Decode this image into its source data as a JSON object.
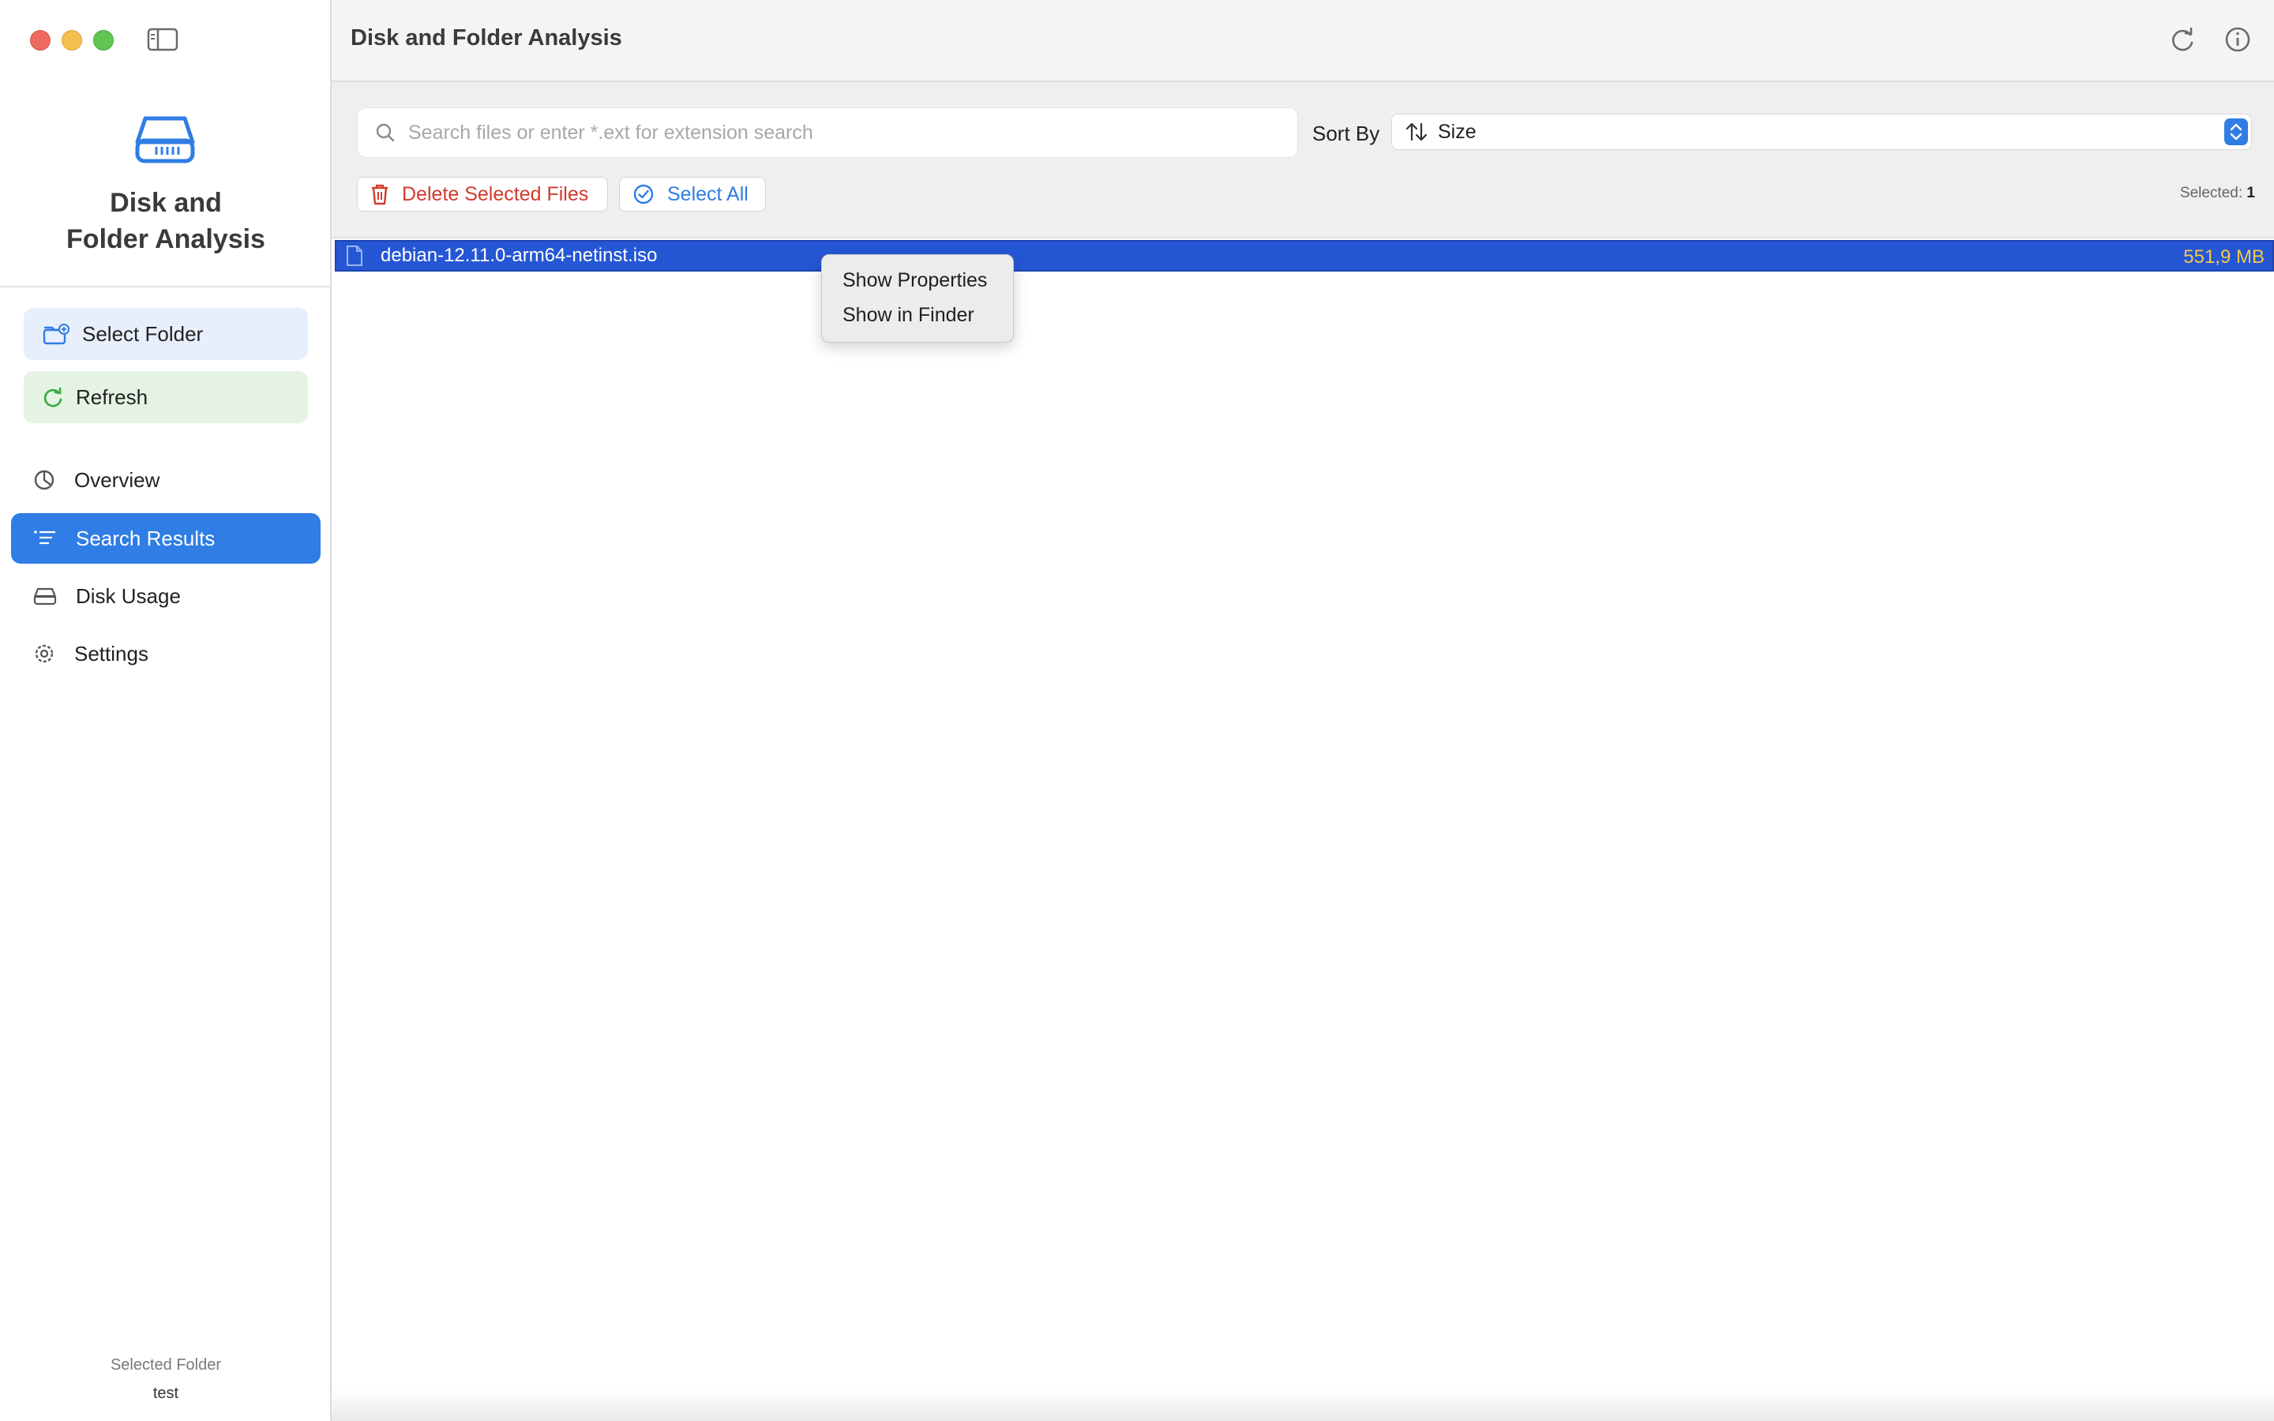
{
  "window": {
    "title": "Disk and Folder Analysis"
  },
  "sidebar": {
    "app_name_line1": "Disk and",
    "app_name_line2": "Folder Analysis",
    "select_folder_label": "Select Folder",
    "refresh_label": "Refresh",
    "nav": [
      {
        "label": "Overview",
        "icon": "clock-chart-icon",
        "active": false
      },
      {
        "label": "Search Results",
        "icon": "list-icon",
        "active": true
      },
      {
        "label": "Disk Usage",
        "icon": "drive-icon",
        "active": false
      },
      {
        "label": "Settings",
        "icon": "gear-icon",
        "active": false
      }
    ],
    "selected_folder_label": "Selected Folder",
    "selected_folder_value": "test"
  },
  "toolbar": {
    "search_placeholder": "Search files or enter *.ext for extension search",
    "search_value": "",
    "sort_label": "Sort By",
    "sort_value": "Size",
    "delete_label": "Delete Selected Files",
    "select_all_label": "Select All",
    "selected_label": "Selected:",
    "selected_count": "1"
  },
  "files": [
    {
      "name": "debian-12.11.0-arm64-netinst.iso",
      "size": "551,9 MB",
      "selected": true
    }
  ],
  "context_menu": {
    "items": [
      "Show Properties",
      "Show in Finder"
    ]
  },
  "colors": {
    "accent": "#2f7de5",
    "selection": "#2556d4",
    "size_text": "#f4c94b",
    "delete": "#d33a2c"
  }
}
